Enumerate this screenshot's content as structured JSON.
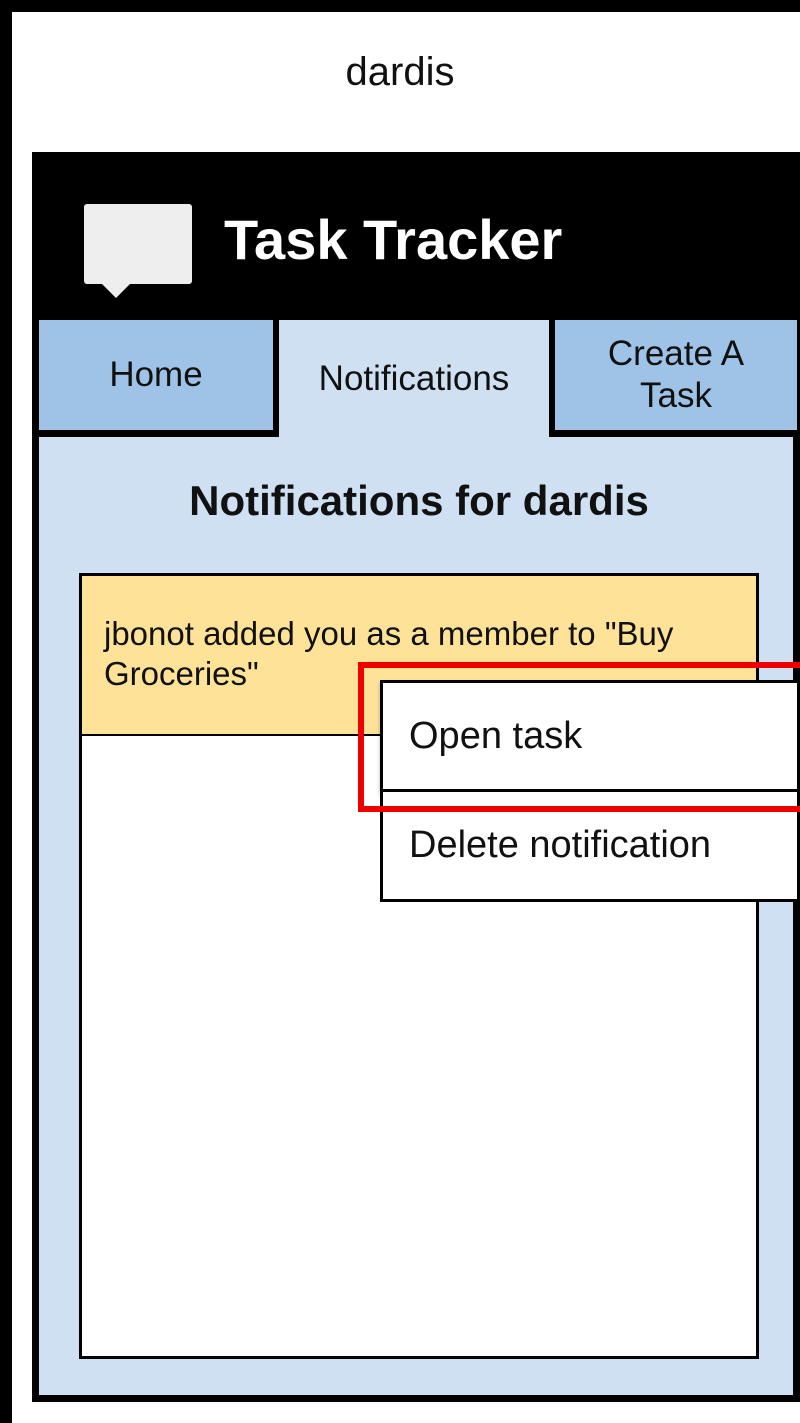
{
  "user": {
    "username": "dardis"
  },
  "app": {
    "title": "Task Tracker",
    "logo_icon": "speech-bubble-icon"
  },
  "tabs": [
    {
      "label": "Home",
      "active": false
    },
    {
      "label": "Notifications",
      "active": true
    },
    {
      "label": "Create A Task",
      "active": false
    }
  ],
  "panel": {
    "heading": "Notifications for dardis"
  },
  "notifications": [
    {
      "text": "jbonot added you as a member to \"Buy Groceries\"",
      "highlighted": true
    }
  ],
  "context_menu": {
    "items": [
      {
        "label": "Open task",
        "highlighted": true
      },
      {
        "label": "Delete notification",
        "highlighted": false
      }
    ]
  },
  "colors": {
    "tab_inactive": "#9fc3e6",
    "tab_active": "#cfe0f2",
    "panel_bg": "#cfe0f2",
    "notification_bg": "#fde298",
    "highlight": "#ee0000",
    "header_bg": "#000000"
  }
}
